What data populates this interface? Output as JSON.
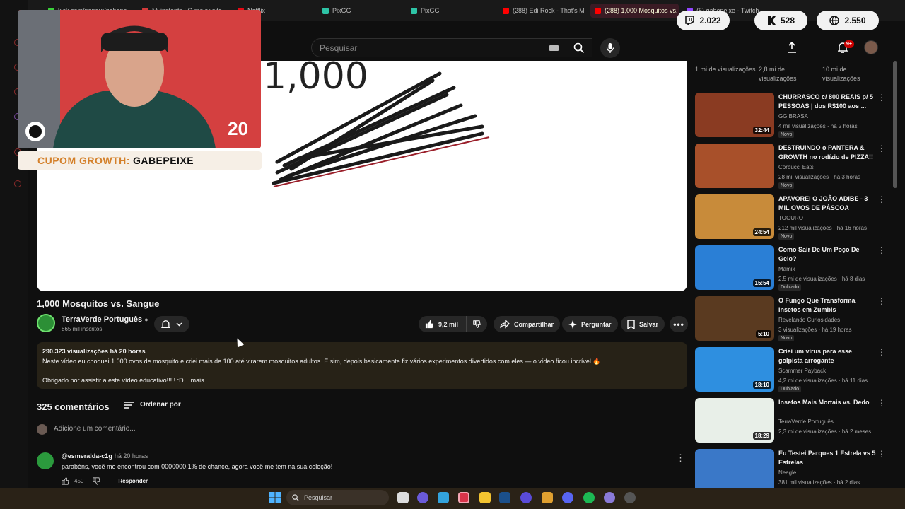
{
  "tabs": [
    {
      "label": "kick.com/popout/gabepe",
      "fav": "#3ad13a"
    },
    {
      "label": "Myinstants | O maior site",
      "fav": "#d23a3a"
    },
    {
      "label": "Netflix",
      "fav": "#e50914"
    },
    {
      "label": "PixGG",
      "fav": "#2ec4a6"
    },
    {
      "label": "PixGG",
      "fav": "#2ec4a6"
    },
    {
      "label": "(288) Edi Rock - That's M",
      "fav": "#ff0000"
    },
    {
      "label": "(288) 1,000 Mosquitos vs.",
      "fav": "#ff0000"
    },
    {
      "label": "(5) gabepeixe - Twitch",
      "fav": "#9146ff"
    }
  ],
  "stats": {
    "viewers_twitch": "2.022",
    "viewers_kick": "528",
    "viewers_total": "2.550"
  },
  "search": {
    "placeholder": "Pesquisar"
  },
  "notifications": {
    "count": "9+"
  },
  "player": {
    "big_number": "1,000"
  },
  "overlay": {
    "cam_number": "20",
    "coupon_label": "CUPOM GROWTH:",
    "coupon_code": "GABEPEIXE"
  },
  "video": {
    "title": "1,000 Mosquitos vs. Sangue",
    "channel": "TerraVerde Português",
    "subscribers": "865 mil inscritos",
    "likes": "9,2 mil",
    "share": "Compartilhar",
    "ask": "Perguntar",
    "save": "Salvar"
  },
  "description": {
    "meta": "290.323 visualizações  há 20 horas",
    "line1": "Neste vídeo eu choquei 1.000 ovos de mosquito e criei mais de 100 até virarem mosquitos adultos. E sim, depois basicamente fiz vários experimentos divertidos com eles — o vídeo ficou incrível 🔥",
    "line2": "Obrigado por assistir a este vídeo educativo!!!!! :D ...mais"
  },
  "comments": {
    "count_label": "325 comentários",
    "sort_label": "Ordenar por",
    "add_placeholder": "Adicione um comentário...",
    "first": {
      "author": "@esmeralda-c1g",
      "time": "há 20 horas",
      "text": "parabéns, você me encontrou com 0000000,1% de chance, agora você me tem na sua coleção!",
      "likes": "450",
      "reply": "Responder"
    }
  },
  "recommendations_header": [
    {
      "views": "1 mi de visualizações"
    },
    {
      "views": "2,8 mi de visualizações"
    },
    {
      "views": "10 mi de visualizações"
    }
  ],
  "recommendations": [
    {
      "title": "CHURRASCO c/ 800 REAIS p/ 5 PESSOAS | dos R$100 aos ...",
      "channel": "GG BRASA",
      "meta": "4 mil visualizações · há 2 horas",
      "duration": "32:44",
      "badge": "Novo",
      "color": "#8a3b22"
    },
    {
      "title": "DESTRUINDO o PANTERA & GROWTH no rodízio de PIZZA!!",
      "channel": "Corbucci Eats",
      "meta": "28 mil visualizações · há 3 horas",
      "duration": "",
      "badge": "Novo",
      "color": "#a8502a"
    },
    {
      "title": "APAVOREI O JOÃO ADIBE - 3 MIL OVOS DE PÁSCOA",
      "channel": "TOGURO",
      "meta": "212 mil visualizações · há 16 horas",
      "duration": "24:54",
      "badge": "Novo",
      "color": "#c88b3a"
    },
    {
      "title": "Como Sair De Um Poço De Gelo?",
      "channel": "Mamix",
      "meta": "2,5 mi de visualizações · há 8 dias",
      "duration": "15:54",
      "badge": "Dublado",
      "color": "#2a7fd6"
    },
    {
      "title": "O Fungo Que Transforma Insetos em Zumbis",
      "channel": "Revelando Curiosidades",
      "meta": "3 visualizações · há 19 horas",
      "duration": "5:10",
      "badge": "Novo",
      "color": "#5a3a20"
    },
    {
      "title": "Criei um vírus para esse golpista arrogante",
      "channel": "Scammer Payback",
      "meta": "4,2 mi de visualizações · há 11 dias",
      "duration": "18:10",
      "badge": "Dublado",
      "color": "#2e8fe0"
    },
    {
      "title": "Insetos Mais Mortais vs. Dedo",
      "channel": "TerraVerde Português",
      "meta": "2,3 mi de visualizações · há 2 meses",
      "duration": "18:29",
      "badge": "",
      "color": "#e8efe8"
    },
    {
      "title": "Eu Testei Parques 1 Estrela vs 5 Estrelas",
      "channel": "Neagle",
      "meta": "381 mil visualizações · há 2 dias",
      "duration": "",
      "badge": "",
      "color": "#3a78c8"
    }
  ],
  "taskbar": {
    "search_placeholder": "Pesquisar"
  }
}
